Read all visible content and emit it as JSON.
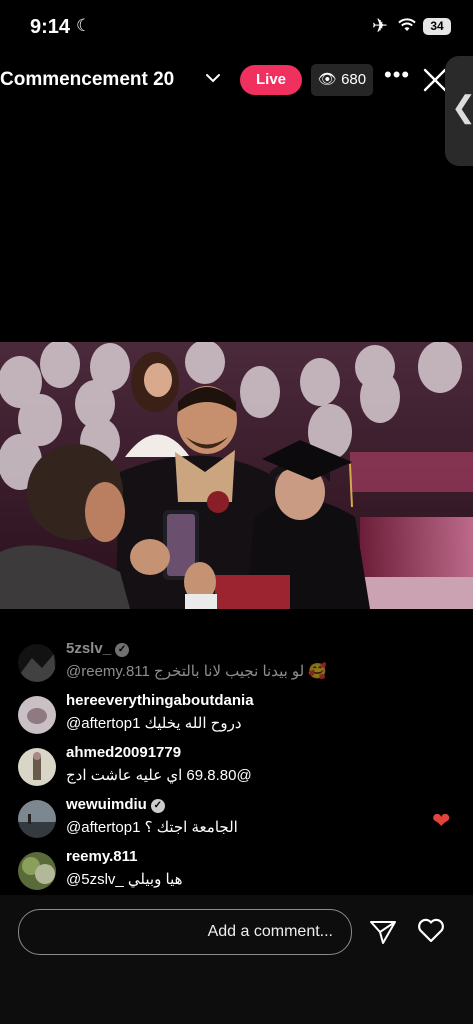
{
  "status": {
    "time": "9:14",
    "battery": "34"
  },
  "header": {
    "title": "Commencement 20",
    "live_label": "Live",
    "viewer_count": "680"
  },
  "comments": [
    {
      "username": "5zslv_",
      "text": "@reemy.811 لو بيدنا نجيب لانا بالتخرج 🥰",
      "verified": true,
      "faded": true
    },
    {
      "username": "hereeverythingaboutdania",
      "text": "@aftertop1 دروح الله يخليك"
    },
    {
      "username": "ahmed20091779",
      "text": "@69.8.80 اي عليه عاشت ادج"
    },
    {
      "username": "wewuimdiu",
      "text": "@aftertop1 الجامعة اجتك ؟",
      "verified": true
    },
    {
      "username": "reemy.811",
      "text": "@5zslv_ هيا وبيلي"
    }
  ],
  "composer": {
    "placeholder": "Add a comment..."
  },
  "colors": {
    "live": "#f0305e",
    "heart": "#e0443a"
  }
}
